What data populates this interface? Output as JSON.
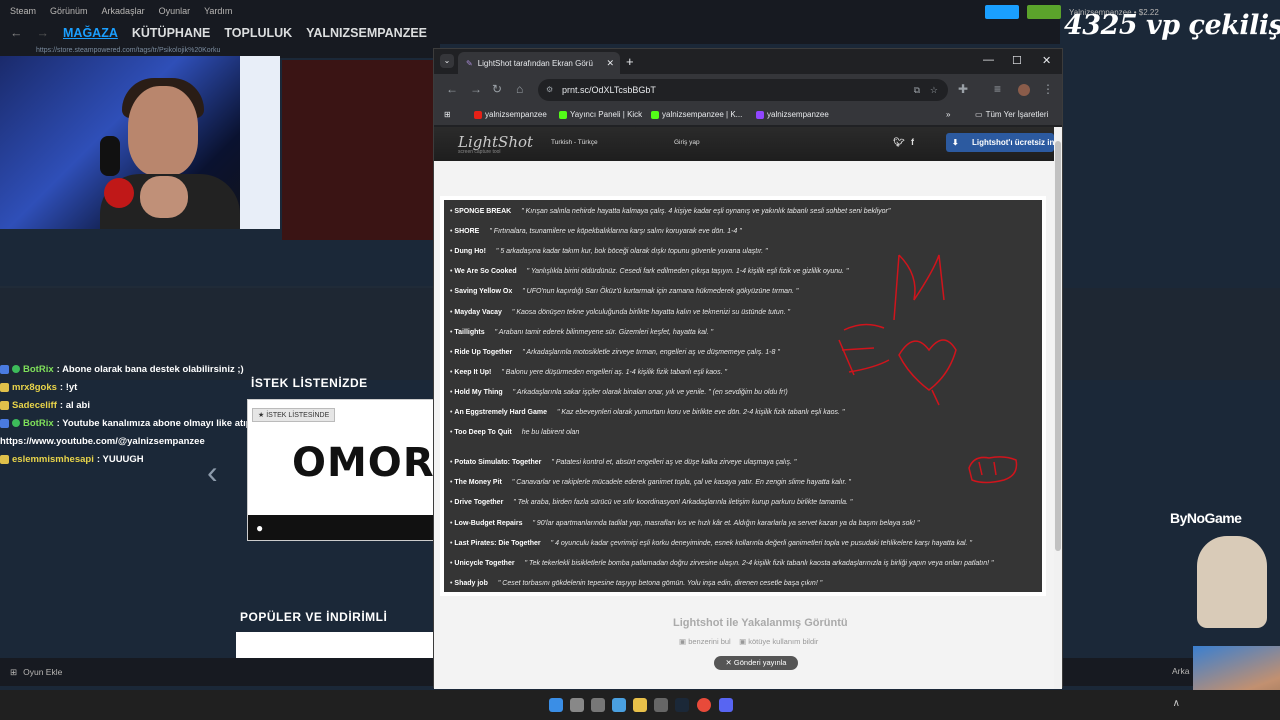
{
  "steam": {
    "menu": [
      "Steam",
      "Görünüm",
      "Arkadaşlar",
      "Oyunlar",
      "Yardım"
    ],
    "nav": [
      "MAĞAZA",
      "KÜTÜPHANE",
      "TOPLULUK",
      "YALNIZSEMPANZEE"
    ],
    "url": "https://store.steampowered.com/tags/tr/Psikolojik%20Korku",
    "user": "Yalnizsempanzee • $2.22",
    "wishlist_title": "İSTEK LİSTENİZDE",
    "wishlist_tag": "★ İSTEK LİSTESİNDE",
    "wishlist_game": "OMORI",
    "popular_title": "POPÜLER VE İNDİRİMLİ",
    "add_game": "Oyun Ekle",
    "arka": "Arka"
  },
  "chat": [
    {
      "user": "BotRix",
      "msg": ": Abone olarak bana destek olabilirsiniz ;)",
      "color": "green",
      "check": true
    },
    {
      "user": "mrx8goks",
      "msg": ": !yt",
      "color": "yellow",
      "check": false
    },
    {
      "user": "Sadeceliff",
      "msg": ": al abi",
      "color": "yellow",
      "check": false
    },
    {
      "user": "BotRix",
      "msg": ": Youtube kanalımıza abone olmayı like atıp yorum yapmayı unutmayınız",
      "color": "green",
      "check": true
    },
    {
      "user": "",
      "msg": "https://www.youtube.com/@yalnizsempanzee",
      "color": "none",
      "check": false
    },
    {
      "user": "eslemmismhesapi",
      "msg": ": YUUUGH",
      "color": "yellow",
      "check": false
    }
  ],
  "overlay": {
    "giveaway": "4325 vp çekiliş",
    "sponsor": "ByNoGame"
  },
  "chrome": {
    "tab_title": "LightShot tarafından Ekran Görü",
    "url": "prnt.sc/OdXLTcsbBGbT",
    "bookmarks": [
      "yalnizsempanzee",
      "Yayıncı Paneli | Kick",
      "yalnizsempanzee | K...",
      "yalnizsempanzee",
      "Tüm Yer İşaretleri"
    ]
  },
  "lightshot": {
    "logo": "LightShot",
    "logo_sub": "screen capture tool",
    "lang": "Turkish - Türkçe",
    "login": "Giriş yap",
    "download": "Lightshot'ı ücretsiz indir",
    "caption": "Lightshot ile Yakalanmış Görüntü",
    "similar": "benzerini bul",
    "report": "kötüye kullanım bildir",
    "post": "Gönderi yayınla",
    "games": [
      {
        "name": "SPONGE BREAK",
        "desc": "\" Kırışan salınla nehirde hayatta kalmaya çalış. 4 kişiye kadar eşli oynanış ve yakınlık tabanlı sesli sohbet seni bekliyor\""
      },
      {
        "name": "SHORE",
        "desc": "\" Fırtınalara, tsunamilere ve köpekbalıklarına karşı salını koruyarak eve dön. 1-4 \""
      },
      {
        "name": "Dung Ho!",
        "desc": "\" 5 arkadaşına kadar takım kur, bok böceği olarak dışkı topunu güvenle yuvana ulaştır. \""
      },
      {
        "name": "We Are So Cooked",
        "desc": "\" Yanlışlıkla birini öldürdünüz. Cesedi fark edilmeden çıkışa taşıyın. 1-4 kişilik eşli fizik ve gizlilik oyunu. \""
      },
      {
        "name": "Saving Yellow Ox",
        "desc": "\" UFO'nun kaçırdığı Sarı Öküz'ü kurtarmak için zamana hükmederek gökyüzüne tırman. \""
      },
      {
        "name": "Mayday Vacay",
        "desc": "\" Kaosa dönüşen tekne yolculuğunda birlikte hayatta kalın ve teknenizi su üstünde tutun. \""
      },
      {
        "name": "Taillights",
        "desc": "\" Arabanı tamir ederek bilinmeyene sür. Gizemleri keşfet, hayatta kal. \""
      },
      {
        "name": "Ride Up Together",
        "desc": "\" Arkadaşlarınla motosikletle zirveye tırman, engelleri aş ve düşmemeye çalış. 1-8 \""
      },
      {
        "name": "Keep It Up!",
        "desc": "\" Balonu yere düşürmeden engelleri aş. 1-4 kişilik fizik tabanlı eşli kaos. \""
      },
      {
        "name": "Hold My Thing",
        "desc": "\" Arkadaşlarınla sakar işçiler olarak binaları onar, yık ve yenile. \" (en sevdiğim bu oldu fr!)"
      },
      {
        "name": "An Eggstremely Hard Game",
        "desc": "\" Kaz ebeveynleri olarak yumurtanı koru ve birlikte eve dön. 2-4 kişilik fizik tabanlı eşli kaos. \""
      },
      {
        "name": "Too Deep To Quit",
        "desc": "he bu labirent olan"
      },
      {
        "name": "Potato Simulato: Together",
        "desc": "\" Patatesi kontrol et, absürt engelleri aş ve düşe kalka zirveye ulaşmaya çalış. \""
      },
      {
        "name": "The Money Pit",
        "desc": "\" Canavarlar ve rakiplerle mücadele ederek ganimet topla, çal ve kasaya yatır. En zengin slime hayatta kalır. \""
      },
      {
        "name": "Drive Together",
        "desc": "\" Tek araba, birden fazla sürücü ve sıfır koordinasyon! Arkadaşlarınla iletişim kurup parkuru birlikte tamamla. \""
      },
      {
        "name": "Low-Budget Repairs",
        "desc": "\" 90'lar apartmanlarında tadilat yap, masrafları kıs ve hızlı kâr et. Aldığın kararlarla ya servet kazan ya da başını belaya sok! \""
      },
      {
        "name": "Last Pirates: Die Together",
        "desc": "\" 4 oyunculu kadar çevrimiçi eşli korku deneyiminde, esnek kollarınla değerli ganimetleri topla ve pusudaki tehlikelere karşı hayatta kal. \""
      },
      {
        "name": "Unicycle Together",
        "desc": "\" Tek tekerlekli bisikletlerle bomba patlamadan doğru zirvesine ulaşın. 2-4 kişilik fizik tabanlı kaosta arkadaşlarınızla iş birliği yapın veya onları patlatın! \""
      },
      {
        "name": "Shady job",
        "desc": "\" Ceset torbasını gökdelenin tepesine taşıyıp betona gömün. Yolu inşa edin, direnen cesetle başa çıkın! \""
      }
    ]
  },
  "colors": {
    "accent": "#1a9fff",
    "chrome_bg": "#35363a",
    "ls_dark": "#353535",
    "scribble": "#d0141c"
  }
}
